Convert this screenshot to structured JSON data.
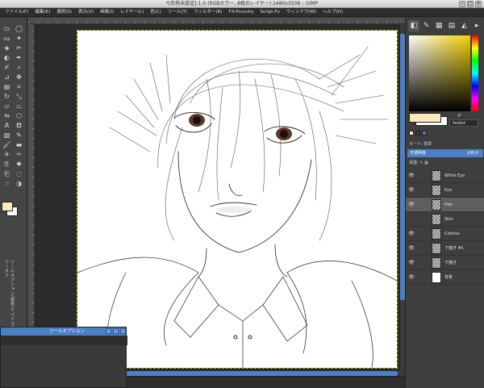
{
  "window": {
    "title": "*[名称未設定]-1.0 (RGBカラー, 8枚のレイヤー) 2480x3508 – GIMP"
  },
  "menu": [
    "ファイル(F)",
    "編集(E)",
    "選択(S)",
    "表示(V)",
    "画像(I)",
    "レイヤー(L)",
    "色(C)",
    "ツール(T)",
    "フィルター(R)",
    "FX-Foundry",
    "Script-Fu",
    "ウィンドウ(W)",
    "ヘルプ(H)"
  ],
  "toolbox": {
    "tools": [
      "rect-select-icon",
      "ellipse-select-icon",
      "lasso-icon",
      "fuzzy-select-icon",
      "select-by-color-icon",
      "scissors-icon",
      "foreground-select-icon",
      "paths-icon",
      "color-picker-icon",
      "zoom-icon",
      "measure-icon",
      "move-icon",
      "align-icon",
      "crop-icon",
      "rotate-icon",
      "scale-icon",
      "shear-icon",
      "perspective-icon",
      "flip-icon",
      "cage-icon",
      "text-icon",
      "bucket-fill-icon",
      "blend-icon",
      "pencil-icon",
      "paintbrush-icon",
      "eraser-icon",
      "airbrush-icon",
      "ink-icon",
      "clone-icon",
      "heal-icon",
      "perspective-clone-icon",
      "blur-icon",
      "smudge-icon",
      "dodge-burn-icon"
    ],
    "vertical_label": "ツールオプション/画像/デバイスステータス"
  },
  "tool_options": {
    "title": "ツールオプション"
  },
  "colors": {
    "foreground": "#fbe8bd",
    "background": "#ffffff",
    "accent": "#4b7fc6"
  },
  "dock": {
    "hex_value": "feebd",
    "mode_label": "モード: 標準",
    "opacity_label": "不透明度",
    "opacity_value": "100.0",
    "lock_label": "保護:",
    "layers": [
      {
        "name": "White Eye",
        "visible": true,
        "selected": false,
        "thumb": "checker"
      },
      {
        "name": "Eye",
        "visible": true,
        "selected": false,
        "thumb": "checker"
      },
      {
        "name": "Hair",
        "visible": true,
        "selected": true,
        "thumb": "checker"
      },
      {
        "name": "Skin",
        "visible": false,
        "selected": false,
        "thumb": "checker"
      },
      {
        "name": "Clothes",
        "visible": true,
        "selected": false,
        "thumb": "checker"
      },
      {
        "name": "下描き #1",
        "visible": true,
        "selected": false,
        "thumb": "checker"
      },
      {
        "name": "下描き",
        "visible": true,
        "selected": false,
        "thumb": "checker"
      },
      {
        "name": "背景",
        "visible": true,
        "selected": false,
        "thumb": "white"
      }
    ]
  }
}
